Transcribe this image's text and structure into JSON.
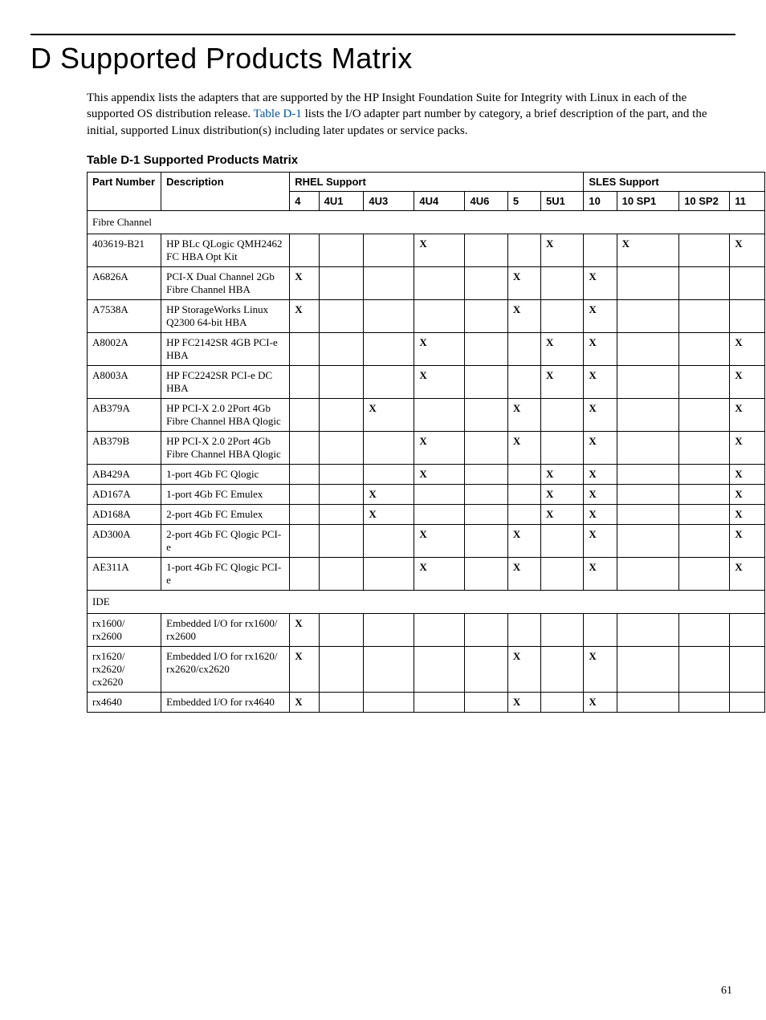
{
  "title": "D Supported Products Matrix",
  "intro_text_1": "This appendix lists the adapters that are supported by the HP Insight Foundation Suite for Integrity with Linux in each of the supported OS distribution release. ",
  "intro_link": "Table D-1",
  "intro_text_2": " lists the I/O adapter part number by category, a brief description of the part, and the initial, supported Linux distribution(s) including later updates or service packs.",
  "table_caption": "Table D-1 Supported Products Matrix",
  "headers": {
    "part_number": "Part Number",
    "description": "Description",
    "rhel": "RHEL Support",
    "sles": "SLES Support",
    "cols": [
      "4",
      "4U1",
      "4U3",
      "4U4",
      "4U6",
      "5",
      "5U1",
      "10",
      "10 SP1",
      "10 SP2",
      "11"
    ]
  },
  "sections": [
    {
      "name": "Fibre Channel"
    },
    {
      "name": "IDE"
    }
  ],
  "rows_fc": [
    {
      "pn": "403619-B21",
      "desc": "HP BLc QLogic QMH2462 FC HBA Opt Kit",
      "m": [
        "",
        "",
        "",
        "X",
        "",
        "",
        "X",
        "",
        "X",
        "",
        "X"
      ]
    },
    {
      "pn": "A6826A",
      "desc": "PCI-X Dual Channel 2Gb Fibre Channel HBA",
      "m": [
        "X",
        "",
        "",
        "",
        "",
        "X",
        "",
        "X",
        "",
        "",
        ""
      ]
    },
    {
      "pn": "A7538A",
      "desc": "HP StorageWorks Linux Q2300 64-bit HBA",
      "m": [
        "X",
        "",
        "",
        "",
        "",
        "X",
        "",
        "X",
        "",
        "",
        ""
      ]
    },
    {
      "pn": "A8002A",
      "desc": "HP FC2142SR 4GB PCI-e HBA",
      "m": [
        "",
        "",
        "",
        "X",
        "",
        "",
        "X",
        "X",
        "",
        "",
        "X"
      ]
    },
    {
      "pn": "A8003A",
      "desc": "HP FC2242SR PCI-e DC HBA",
      "m": [
        "",
        "",
        "",
        "X",
        "",
        "",
        "X",
        "X",
        "",
        "",
        "X"
      ]
    },
    {
      "pn": "AB379A",
      "desc": "HP PCI-X 2.0 2Port 4Gb Fibre Channel HBA Qlogic",
      "m": [
        "",
        "",
        "X",
        "",
        "",
        "X",
        "",
        "X",
        "",
        "",
        "X"
      ]
    },
    {
      "pn": "AB379B",
      "desc": "HP PCI-X 2.0 2Port 4Gb Fibre Channel HBA Qlogic",
      "m": [
        "",
        "",
        "",
        "X",
        "",
        "X",
        "",
        "X",
        "",
        "",
        "X"
      ]
    },
    {
      "pn": "AB429A",
      "desc": "1-port 4Gb FC Qlogic",
      "m": [
        "",
        "",
        "",
        "X",
        "",
        "",
        "X",
        "X",
        "",
        "",
        "X"
      ]
    },
    {
      "pn": "AD167A",
      "desc": "1-port 4Gb FC Emulex",
      "m": [
        "",
        "",
        "X",
        "",
        "",
        "",
        "X",
        "X",
        "",
        "",
        "X"
      ]
    },
    {
      "pn": "AD168A",
      "desc": "2-port 4Gb FC Emulex",
      "m": [
        "",
        "",
        "X",
        "",
        "",
        "",
        "X",
        "X",
        "",
        "",
        "X"
      ]
    },
    {
      "pn": "AD300A",
      "desc": "2-port 4Gb FC Qlogic PCI-e",
      "m": [
        "",
        "",
        "",
        "X",
        "",
        "X",
        "",
        "X",
        "",
        "",
        "X"
      ]
    },
    {
      "pn": "AE311A",
      "desc": "1-port 4Gb FC Qlogic PCI-e",
      "m": [
        "",
        "",
        "",
        "X",
        "",
        "X",
        "",
        "X",
        "",
        "",
        "X"
      ]
    }
  ],
  "rows_ide": [
    {
      "pn": "rx1600/ rx2600",
      "desc": "Embedded I/O for rx1600/ rx2600",
      "m": [
        "X",
        "",
        "",
        "",
        "",
        "",
        "",
        "",
        "",
        "",
        ""
      ]
    },
    {
      "pn": "rx1620/ rx2620/ cx2620",
      "desc": "Embedded I/O for rx1620/ rx2620/cx2620",
      "m": [
        "X",
        "",
        "",
        "",
        "",
        "X",
        "",
        "X",
        "",
        "",
        ""
      ]
    },
    {
      "pn": "rx4640",
      "desc": "Embedded I/O for rx4640",
      "m": [
        "X",
        "",
        "",
        "",
        "",
        "X",
        "",
        "X",
        "",
        "",
        ""
      ]
    }
  ],
  "page_number": "61"
}
